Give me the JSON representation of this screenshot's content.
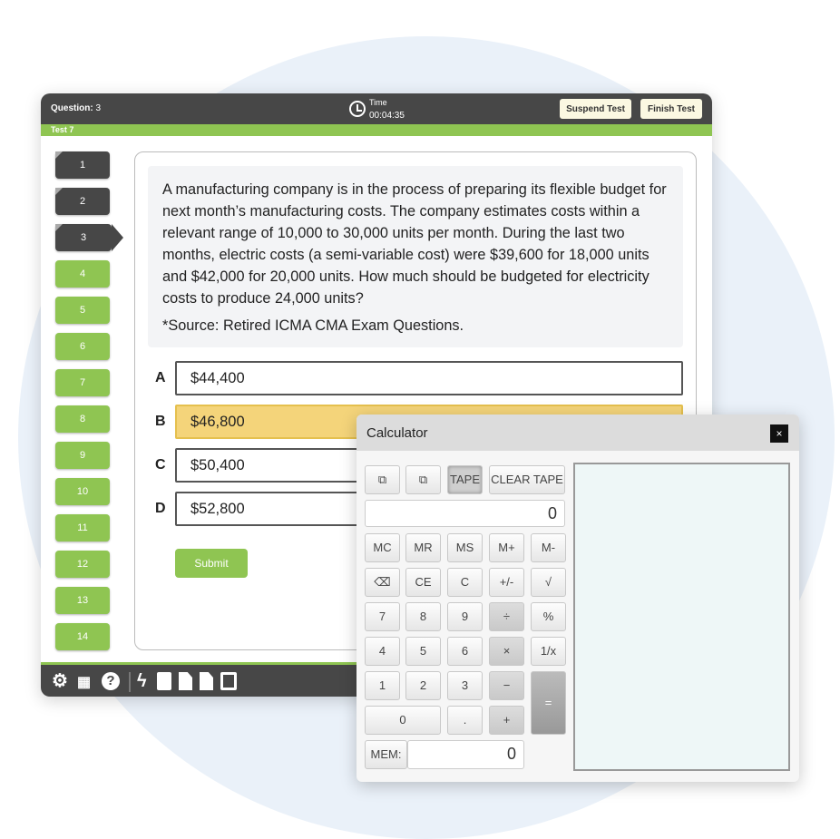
{
  "header": {
    "question_label": "Question:",
    "question_number": "3",
    "time_label": "Time",
    "time_value": "00:04:35",
    "suspend": "Suspend Test",
    "finish": "Finish Test",
    "test_name": "Test 7"
  },
  "nav": [
    {
      "n": "1",
      "state": "answered"
    },
    {
      "n": "2",
      "state": "answered"
    },
    {
      "n": "3",
      "state": "current"
    },
    {
      "n": "4",
      "state": "open"
    },
    {
      "n": "5",
      "state": "open"
    },
    {
      "n": "6",
      "state": "open"
    },
    {
      "n": "7",
      "state": "open"
    },
    {
      "n": "8",
      "state": "open"
    },
    {
      "n": "9",
      "state": "open"
    },
    {
      "n": "10",
      "state": "open"
    },
    {
      "n": "11",
      "state": "open"
    },
    {
      "n": "12",
      "state": "open"
    },
    {
      "n": "13",
      "state": "open"
    },
    {
      "n": "14",
      "state": "open"
    }
  ],
  "question": {
    "text": "A manufacturing company is in the process of preparing its flexible budget for next month’s manufacturing costs. The company estimates costs within a relevant range of 10,000 to 30,000 units per month. During the last two months, electric costs (a semi-variable cost) were $39,600 for 18,000 units and $42,000 for 20,000 units. How much should be budgeted for electricity costs to produce 24,000 units?",
    "source": "*Source: Retired ICMA CMA Exam Questions."
  },
  "options": [
    {
      "letter": "A",
      "text": "$44,400"
    },
    {
      "letter": "B",
      "text": "$46,800",
      "selected": true
    },
    {
      "letter": "C",
      "text": "$50,400"
    },
    {
      "letter": "D",
      "text": "$52,800"
    }
  ],
  "submit": "Submit",
  "footer_icons": [
    "gear-icon",
    "grid-icon",
    "help-icon",
    "flash-icon",
    "notes-icon",
    "pdf-edit-icon",
    "pdf-icon",
    "calculator-icon"
  ],
  "calculator": {
    "title": "Calculator",
    "close": "×",
    "tape": "TAPE",
    "clear_tape": "CLEAR TAPE",
    "display": "0",
    "mem_label": "MEM:",
    "mem_value": "0",
    "keys": [
      [
        "MC",
        "MR",
        "MS",
        "M+",
        "M-"
      ],
      [
        "⌫",
        "CE",
        "C",
        "+/-",
        "√"
      ],
      [
        "7",
        "8",
        "9",
        "÷",
        "%"
      ],
      [
        "4",
        "5",
        "6",
        "×",
        "1/x"
      ],
      [
        "1",
        "2",
        "3",
        "−",
        "="
      ],
      [
        "0",
        ".",
        "+"
      ]
    ]
  },
  "colors": {
    "green": "#8fc552",
    "dark": "#474747",
    "selected": "#f4d47a"
  }
}
